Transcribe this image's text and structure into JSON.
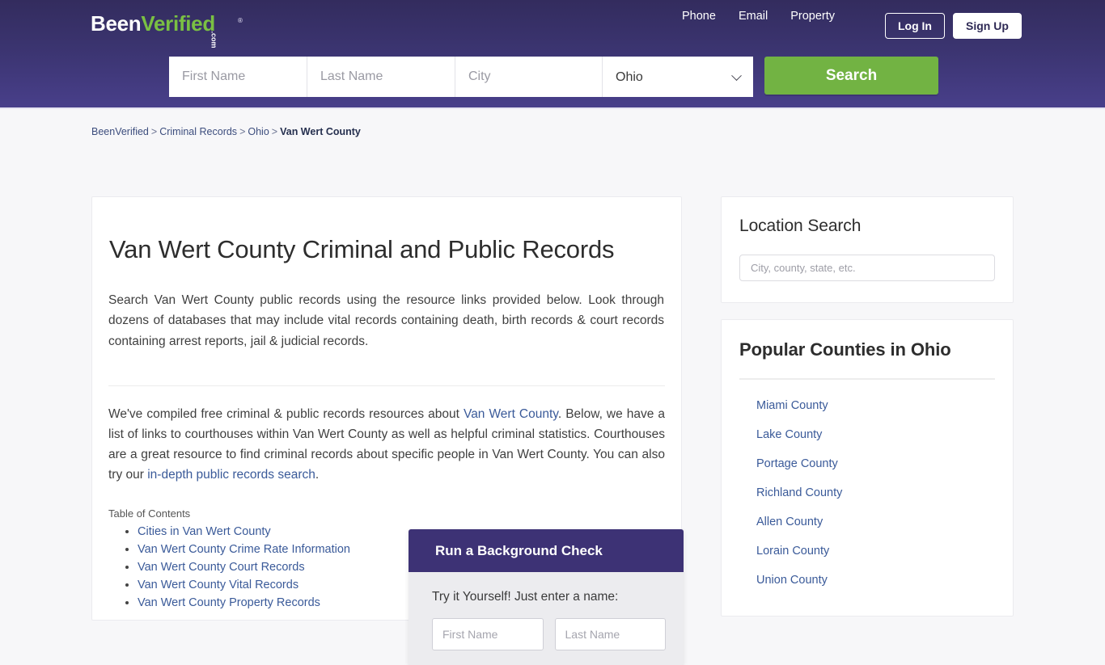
{
  "header": {
    "logo": {
      "part1": "Been",
      "part2": "Verified",
      "suffix": ".com",
      "registered": "®"
    },
    "nav": [
      {
        "label": "Phone"
      },
      {
        "label": "Email"
      },
      {
        "label": "Property"
      }
    ],
    "auth": {
      "login_label": "Log In",
      "signup_label": "Sign Up"
    },
    "search": {
      "first_name_placeholder": "First Name",
      "first_name_value": "",
      "last_name_placeholder": "Last Name",
      "last_name_value": "",
      "city_placeholder": "City",
      "city_value": "",
      "state_selected": "Ohio",
      "state_options": [
        "Ohio"
      ],
      "search_label": "Search"
    },
    "colors": {
      "gradient_top": "#332c5e",
      "gradient_bottom": "#483f8a",
      "accent_green": "#72b343",
      "logo_green": "#7ac043"
    }
  },
  "breadcrumb": {
    "items": [
      {
        "label": "BeenVerified"
      },
      {
        "label": "Criminal Records"
      },
      {
        "label": "Ohio"
      }
    ],
    "separator": ">",
    "current": "Van Wert County"
  },
  "main": {
    "title": "Van Wert County Criminal and Public Records",
    "intro": "Search Van Wert County public records using the resource links provided below. Look through dozens of databases that may include vital records containing death, birth records & court records containing arrest reports, jail & judicial records.",
    "body": {
      "part1": "We've compiled free criminal & public records resources about ",
      "link1": "Van Wert County",
      "part2": ". Below, we have a list of links to courthouses within Van Wert County as well as helpful criminal statistics. Courthouses are a great resource to find criminal records about specific people in Van Wert County. You can also try our ",
      "link2": "in-depth public records search",
      "part3": "."
    },
    "toc": {
      "label": "Table of Contents",
      "items": [
        {
          "label": "Cities in Van Wert County"
        },
        {
          "label": "Van Wert County Crime Rate Information"
        },
        {
          "label": "Van Wert County Court Records"
        },
        {
          "label": "Van Wert County Vital Records"
        },
        {
          "label": "Van Wert County Property Records"
        }
      ]
    }
  },
  "background_check": {
    "title": "Run a Background Check",
    "prompt": "Try it Yourself! Just enter a name:",
    "first_name_placeholder": "First Name",
    "first_name_value": "",
    "last_name_placeholder": "Last Name",
    "last_name_value": ""
  },
  "sidebar": {
    "location_search": {
      "title": "Location Search",
      "input_placeholder": "City, county, state, etc.",
      "input_value": ""
    },
    "popular_counties": {
      "title": "Popular Counties in Ohio",
      "items": [
        {
          "label": "Miami County"
        },
        {
          "label": "Lake County"
        },
        {
          "label": "Portage County"
        },
        {
          "label": "Richland County"
        },
        {
          "label": "Allen County"
        },
        {
          "label": "Lorain County"
        },
        {
          "label": "Union County"
        }
      ]
    }
  }
}
